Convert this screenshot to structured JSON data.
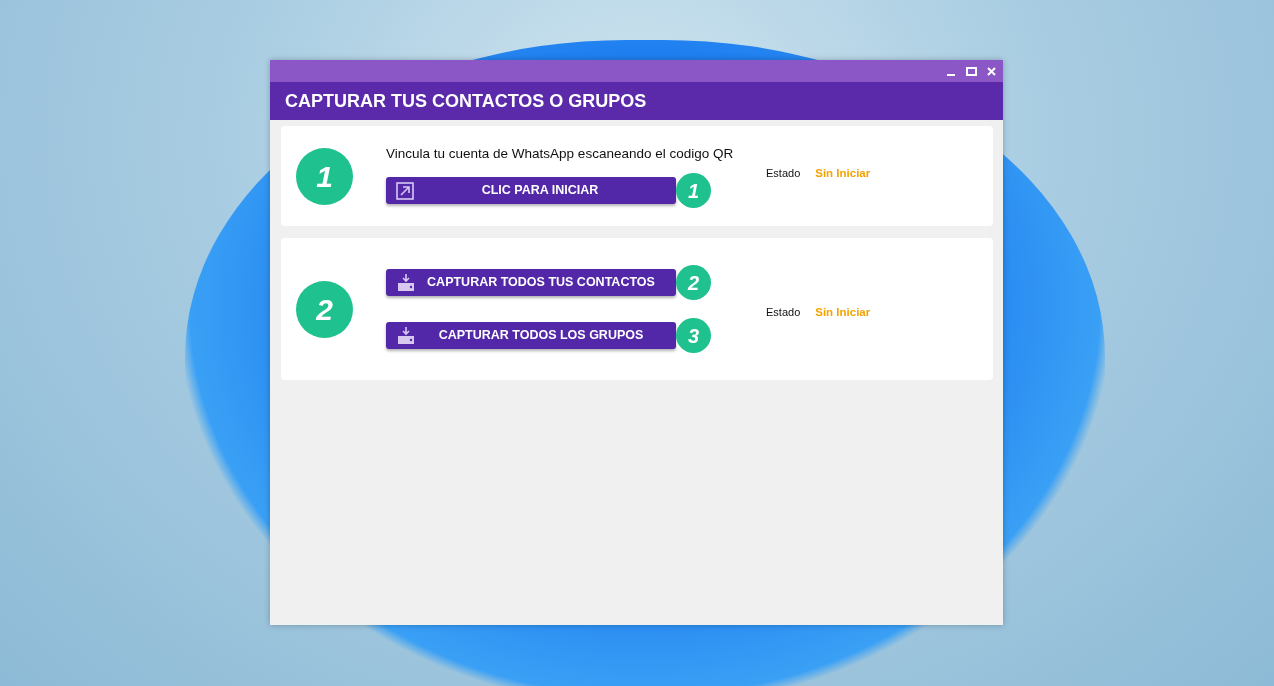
{
  "window": {
    "title": "CAPTURAR TUS CONTACTOS O GRUPOS"
  },
  "steps": [
    {
      "number": "1",
      "instruction": "Vincula tu cuenta de WhatsApp escaneando el codigo QR",
      "actions": [
        {
          "kind": "open",
          "label": "CLIC PARA INICIAR",
          "badge": "1"
        }
      ],
      "status_label": "Estado",
      "status_value": "Sin Iniciar"
    },
    {
      "number": "2",
      "actions": [
        {
          "kind": "download",
          "label": "CAPTURAR TODOS TUS CONTACTOS",
          "badge": "2"
        },
        {
          "kind": "download",
          "label": "CAPTURAR TODOS LOS GRUPOS",
          "badge": "3"
        }
      ],
      "status_label": "Estado",
      "status_value": "Sin Iniciar"
    }
  ]
}
